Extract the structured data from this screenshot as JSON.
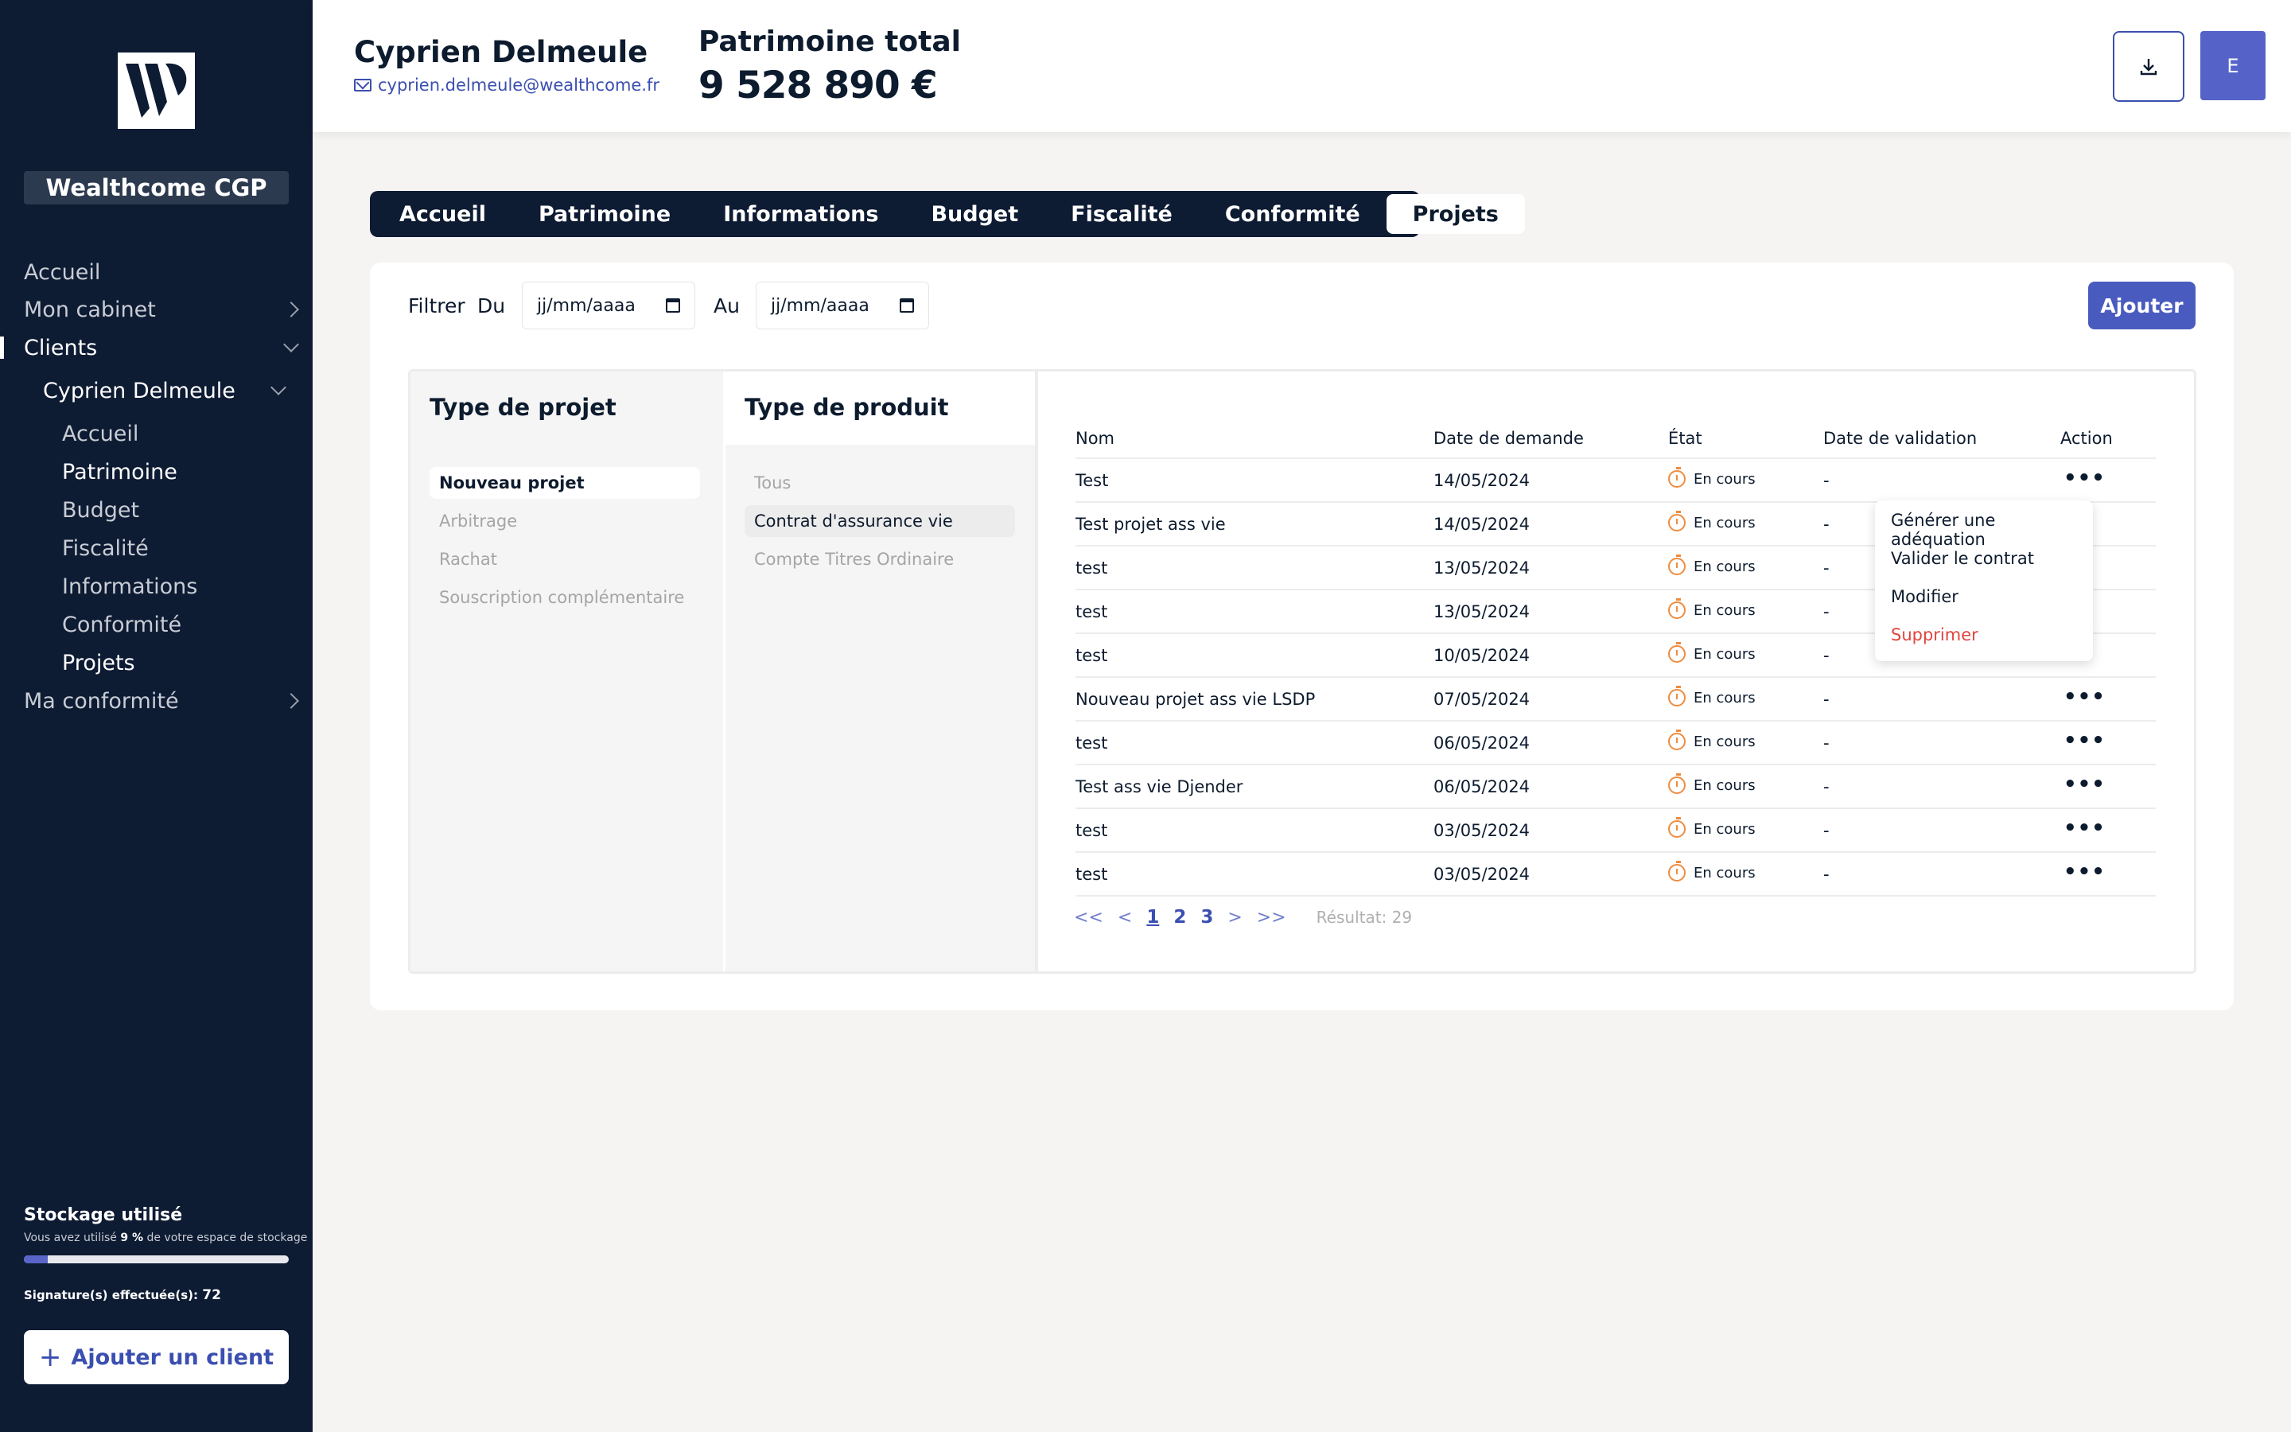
{
  "sidebar": {
    "brand": "Wealthcome CGP",
    "items": [
      {
        "label": "Accueil"
      },
      {
        "label": "Mon cabinet"
      },
      {
        "label": "Clients"
      },
      {
        "label": "Cyprien Delmeule"
      },
      {
        "label": "Accueil"
      },
      {
        "label": "Patrimoine"
      },
      {
        "label": "Budget"
      },
      {
        "label": "Fiscalité"
      },
      {
        "label": "Informations"
      },
      {
        "label": "Conformité"
      },
      {
        "label": "Projets"
      },
      {
        "label": "Ma conformité"
      }
    ],
    "storage_title": "Stockage utilisé",
    "storage_prefix": "Vous avez utilisé",
    "storage_value": "9 %",
    "storage_suffix": "de votre espace de stockage",
    "storage_fraction": 0.09,
    "signatures_label": "Signature(s) effectuée(s):",
    "signatures_count": "72",
    "add_client": "Ajouter un client"
  },
  "header": {
    "client_name": "Cyprien Delmeule",
    "client_email": "cyprien.delmeule@wealthcome.fr",
    "patrimoine_label": "Patrimoine total",
    "patrimoine_value": "9 528 890 €",
    "avatar_initial": "E"
  },
  "tabs": [
    {
      "label": "Accueil"
    },
    {
      "label": "Patrimoine"
    },
    {
      "label": "Informations"
    },
    {
      "label": "Budget"
    },
    {
      "label": "Fiscalité"
    },
    {
      "label": "Conformité"
    },
    {
      "label": "Projets"
    }
  ],
  "filter": {
    "label": "Filtrer",
    "du": "Du",
    "au": "Au",
    "date_placeholder": "jj/mm/aaaa",
    "add_button": "Ajouter"
  },
  "project_types": {
    "title": "Type de projet",
    "options": [
      "Nouveau projet",
      "Arbitrage",
      "Rachat",
      "Souscription complémentaire"
    ]
  },
  "product_types": {
    "title": "Type de produit",
    "options": [
      "Tous",
      "Contrat d'assurance vie",
      "Compte Titres Ordinaire"
    ]
  },
  "table": {
    "headers": [
      "Nom",
      "Date de demande",
      "État",
      "Date de validation",
      "Action"
    ],
    "rows": [
      {
        "nom": "Test",
        "date": "14/05/2024",
        "etat": "En cours",
        "validation": "-"
      },
      {
        "nom": "Test projet ass vie",
        "date": "14/05/2024",
        "etat": "En cours",
        "validation": "-"
      },
      {
        "nom": "test",
        "date": "13/05/2024",
        "etat": "En cours",
        "validation": "-"
      },
      {
        "nom": "test",
        "date": "13/05/2024",
        "etat": "En cours",
        "validation": "-"
      },
      {
        "nom": "test",
        "date": "10/05/2024",
        "etat": "En cours",
        "validation": "-"
      },
      {
        "nom": "Nouveau projet ass vie LSDP",
        "date": "07/05/2024",
        "etat": "En cours",
        "validation": "-"
      },
      {
        "nom": "test",
        "date": "06/05/2024",
        "etat": "En cours",
        "validation": "-"
      },
      {
        "nom": "Test ass vie Djender",
        "date": "06/05/2024",
        "etat": "En cours",
        "validation": "-"
      },
      {
        "nom": "test",
        "date": "03/05/2024",
        "etat": "En cours",
        "validation": "-"
      },
      {
        "nom": "test",
        "date": "03/05/2024",
        "etat": "En cours",
        "validation": "-"
      }
    ],
    "actions_glyph": "•••"
  },
  "context_menu": {
    "items": [
      "Générer une adéquation",
      "Valider le contrat",
      "Modifier",
      "Supprimer"
    ]
  },
  "pagination": {
    "first": "<<",
    "prev": "<",
    "pages": [
      "1",
      "2",
      "3"
    ],
    "next": ">",
    "last": ">>",
    "result_label": "Résultat: 29"
  }
}
